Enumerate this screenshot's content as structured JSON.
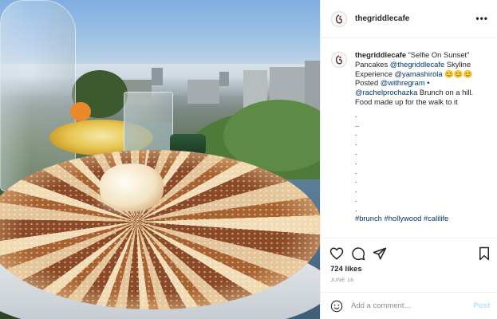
{
  "post": {
    "username": "thegriddlecafe",
    "more_label": "•••"
  },
  "caption": {
    "username": "thegriddlecafe",
    "text_1": "“Selfie On Sunset” Pancakes",
    "mention_1": "@thegriddlecafe",
    "text_2": "Skyline Experience",
    "mention_2": "@yamashirola",
    "emojis": "😊😊😊",
    "text_3": "Posted",
    "mention_3": "@withregram",
    "bullet": "•",
    "mention_4": "@rachelprochazka",
    "text_4": "Brunch on a hill. Food made up for the walk to it",
    "dots": [
      ".",
      "..",
      ".",
      ".",
      ".",
      ".",
      ".",
      ".",
      ".",
      ".",
      "."
    ],
    "hashtags": "#brunch #hollywood #calilife"
  },
  "actions": {
    "likes": "724 likes",
    "date": "JUNE 16"
  },
  "comment_box": {
    "placeholder": "Add a comment…",
    "post_label": "Post"
  },
  "colors": {
    "link": "#00376b",
    "post_disabled": "#b2dffc",
    "muted": "#8e8e8e"
  },
  "icons": [
    "more-options-icon",
    "heart-icon",
    "comment-icon",
    "share-icon",
    "bookmark-icon",
    "emoji-icon"
  ]
}
